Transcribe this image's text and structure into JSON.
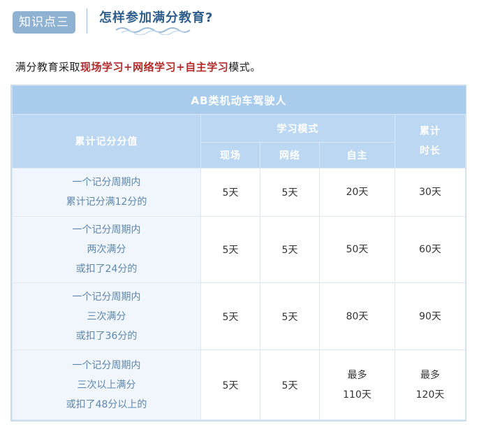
{
  "header": {
    "badge": "知识点三",
    "title": "怎样参加满分教育?"
  },
  "intro": {
    "prefix": "满分教育采取",
    "mode1": "现场学习",
    "plus1": "+",
    "mode2": "网络学习",
    "plus2": "+",
    "mode3": "自主学习",
    "suffix": "模式。"
  },
  "table": {
    "title": "AB类机动车驾驶人",
    "col_condition": "累计记分分值",
    "col_mode_group": "学习模式",
    "col_onsite": "现场",
    "col_online": "网络",
    "col_self": "自主",
    "col_total_line1": "累计",
    "col_total_line2": "时长",
    "rows": [
      {
        "condition": [
          "一个记分周期内",
          "累计记分满12分的"
        ],
        "onsite": "5天",
        "online": "5天",
        "self": [
          "20天"
        ],
        "total": [
          "30天"
        ]
      },
      {
        "condition": [
          "一个记分周期内",
          "两次满分",
          "或扣了24分的"
        ],
        "onsite": "5天",
        "online": "5天",
        "self": [
          "50天"
        ],
        "total": [
          "60天"
        ]
      },
      {
        "condition": [
          "一个记分周期内",
          "三次满分",
          "或扣了36分的"
        ],
        "onsite": "5天",
        "online": "5天",
        "self": [
          "80天"
        ],
        "total": [
          "90天"
        ]
      },
      {
        "condition": [
          "一个记分周期内",
          "三次以上满分",
          "或扣了48分以上的"
        ],
        "onsite": "5天",
        "online": "5天",
        "self": [
          "最多",
          "110天"
        ],
        "total": [
          "最多",
          "120天"
        ]
      }
    ]
  },
  "colors": {
    "badge_bg": "#8fb2d3",
    "title_text": "#2f5e8c",
    "highlight_text": "#b02a2a",
    "table_header_dark": "#a9cbec",
    "table_header_light": "#bcd7f1",
    "condition_text": "#5d87ad"
  }
}
